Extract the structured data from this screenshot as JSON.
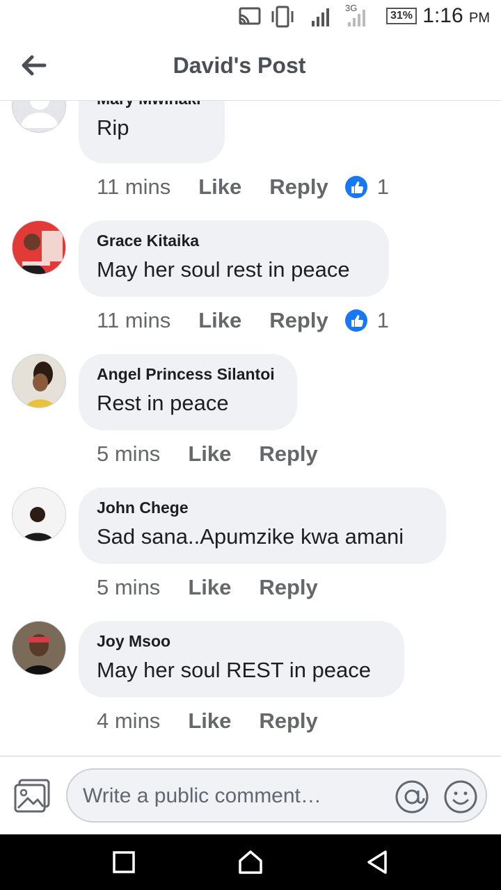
{
  "status_bar": {
    "time": "1:16",
    "ampm": "PM",
    "battery": "31%",
    "network": "3G",
    "icons": [
      "cast-icon",
      "vibrate-icon",
      "signal-icon",
      "signal-3g-icon",
      "battery-icon"
    ]
  },
  "header": {
    "title": "David's Post",
    "back_icon": "arrow-left-icon"
  },
  "comments": [
    {
      "author": "Mary Mwihaki",
      "text": "Rip",
      "time": "11 mins",
      "like": "Like",
      "reply": "Reply",
      "reactions": "1"
    },
    {
      "author": "Grace Kitaika",
      "text": "May her soul rest in peace",
      "time": "11 mins",
      "like": "Like",
      "reply": "Reply",
      "reactions": "1"
    },
    {
      "author": "Angel Princess Silantoi",
      "text": "Rest in peace",
      "time": "5 mins",
      "like": "Like",
      "reply": "Reply"
    },
    {
      "author": "John Chege",
      "text": "Sad sana..Apumzike kwa amani",
      "time": "5 mins",
      "like": "Like",
      "reply": "Reply"
    },
    {
      "author": "Joy Msoo",
      "text": "May her soul REST in peace",
      "time": "4 mins",
      "like": "Like",
      "reply": "Reply"
    }
  ],
  "composer": {
    "placeholder": "Write a public comment…",
    "icons": [
      "photo-icon",
      "at-sign-icon",
      "emoji-icon"
    ]
  },
  "nav": {
    "icons": [
      "recents-icon",
      "home-icon",
      "back-icon"
    ]
  },
  "colors": {
    "accent": "#1877f2",
    "bubble": "#f0f1f4",
    "meta_text": "#65676b",
    "title_text": "#4b4f56"
  }
}
